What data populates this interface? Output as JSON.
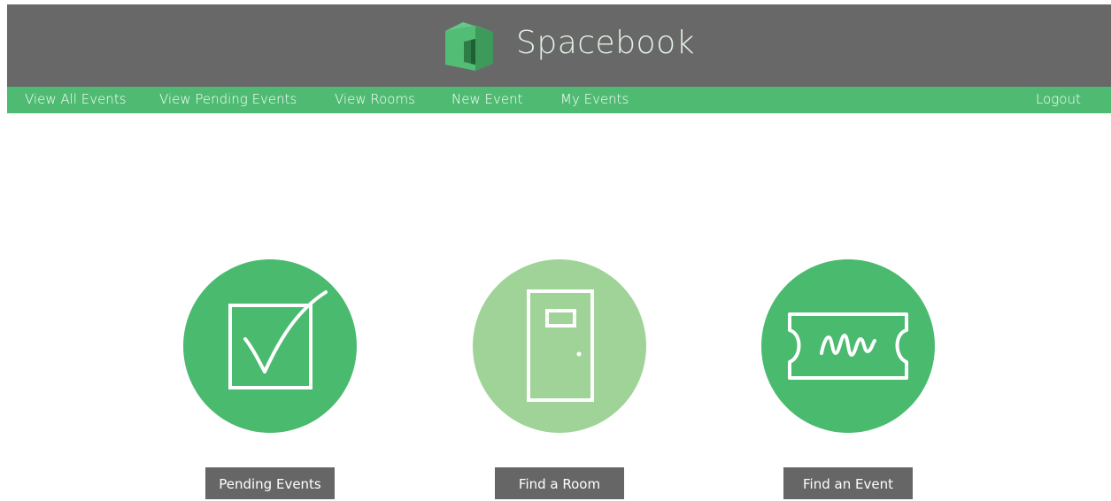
{
  "app": {
    "name": "Spacebook"
  },
  "colors": {
    "header_bg": "#686868",
    "nav_bg": "#4fbb72",
    "accent_green": "#4aba6f",
    "light_green": "#9fd398",
    "button_bg": "#666666"
  },
  "nav": {
    "items": [
      {
        "label": "View All Events"
      },
      {
        "label": "View Pending Events"
      },
      {
        "label": "View Rooms"
      },
      {
        "label": "New Event"
      },
      {
        "label": "My Events"
      }
    ],
    "logout_label": "Logout"
  },
  "features": [
    {
      "icon": "checkbox-icon",
      "label": "Pending Events"
    },
    {
      "icon": "door-icon",
      "label": "Find a Room"
    },
    {
      "icon": "ticket-icon",
      "label": "Find an Event"
    }
  ]
}
